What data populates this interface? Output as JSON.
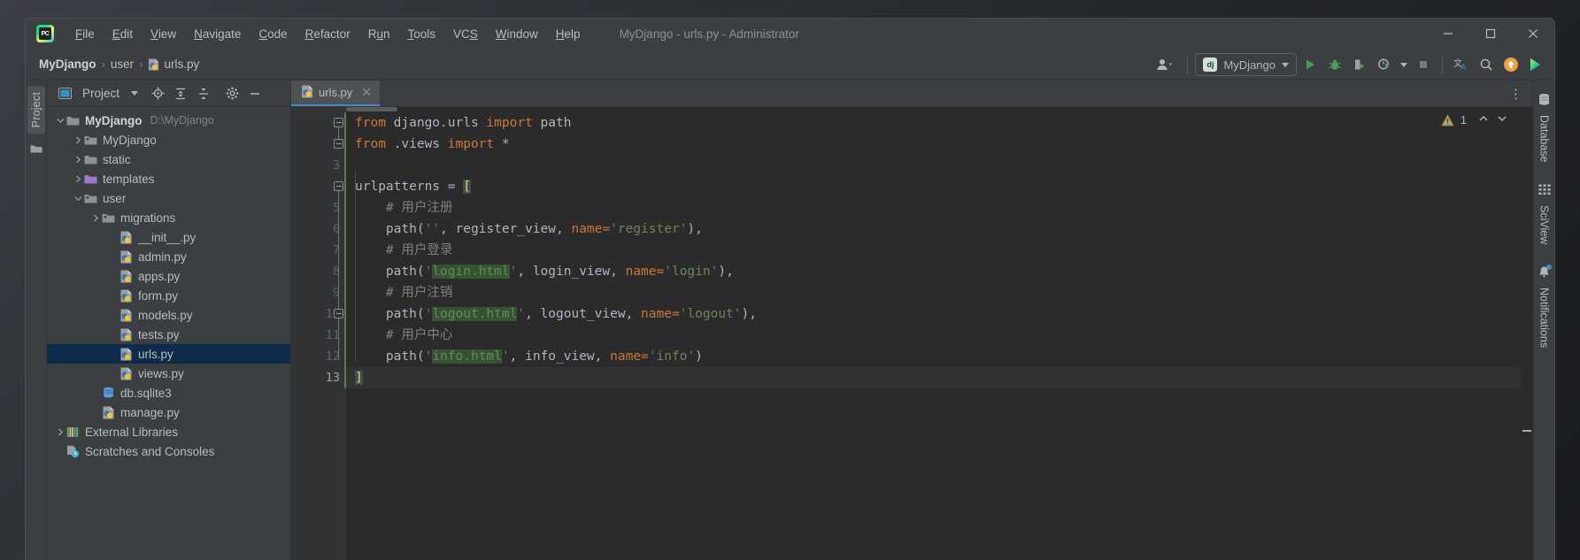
{
  "window": {
    "title": "MyDjango - urls.py - Administrator",
    "logo_text": "PC",
    "minimize": "—",
    "maximize": "□",
    "close": "✕"
  },
  "menu": {
    "items": [
      {
        "label": "File",
        "mnemonic": "F"
      },
      {
        "label": "Edit",
        "mnemonic": "E"
      },
      {
        "label": "View",
        "mnemonic": "V"
      },
      {
        "label": "Navigate",
        "mnemonic": "N"
      },
      {
        "label": "Code",
        "mnemonic": "C"
      },
      {
        "label": "Refactor",
        "mnemonic": "R"
      },
      {
        "label": "Run",
        "mnemonic": "u"
      },
      {
        "label": "Tools",
        "mnemonic": "T"
      },
      {
        "label": "VCS",
        "mnemonic": "S"
      },
      {
        "label": "Window",
        "mnemonic": "W"
      },
      {
        "label": "Help",
        "mnemonic": "H"
      }
    ]
  },
  "navbar": {
    "breadcrumb": [
      {
        "label": "MyDjango",
        "icon": "",
        "bold": true
      },
      {
        "label": "user",
        "icon": "",
        "bold": false
      },
      {
        "label": "urls.py",
        "icon": "python-file-icon",
        "bold": false
      }
    ],
    "separator": "›",
    "run_config": {
      "label": "MyDjango",
      "badge": "dj"
    },
    "icons": [
      "user-account-icon",
      "run-icon",
      "debug-icon",
      "coverage-icon",
      "profile-icon",
      "stop-icon",
      "translate-icon",
      "search-icon",
      "update-icon",
      "ide-features-icon"
    ]
  },
  "left_strip": {
    "tab_label": "Project",
    "folder_icon": "folder-icon"
  },
  "project_panel": {
    "title": "Project",
    "header_icons": [
      "project-view-icon",
      "chevron-down-icon",
      "locate-icon",
      "expand-all-icon",
      "collapse-all-icon",
      "settings-gear-icon",
      "hide-icon"
    ],
    "tree": [
      {
        "depth": 0,
        "label": "MyDjango",
        "path": "D:\\MyDjango",
        "icon": "folder-icon",
        "arrow": "down",
        "bold": true,
        "selected": false
      },
      {
        "depth": 1,
        "label": "MyDjango",
        "path": "",
        "icon": "module-folder-icon",
        "arrow": "right",
        "bold": false,
        "selected": false
      },
      {
        "depth": 1,
        "label": "static",
        "path": "",
        "icon": "folder-icon",
        "arrow": "right",
        "bold": false,
        "selected": false
      },
      {
        "depth": 1,
        "label": "templates",
        "path": "",
        "icon": "templates-folder-icon",
        "arrow": "right",
        "bold": false,
        "selected": false
      },
      {
        "depth": 1,
        "label": "user",
        "path": "",
        "icon": "module-folder-icon",
        "arrow": "down",
        "bold": false,
        "selected": false
      },
      {
        "depth": 2,
        "label": "migrations",
        "path": "",
        "icon": "module-folder-icon",
        "arrow": "right",
        "bold": false,
        "selected": false
      },
      {
        "depth": 3,
        "label": "__init__.py",
        "path": "",
        "icon": "python-file-icon",
        "arrow": "none",
        "bold": false,
        "selected": false
      },
      {
        "depth": 3,
        "label": "admin.py",
        "path": "",
        "icon": "python-file-icon",
        "arrow": "none",
        "bold": false,
        "selected": false
      },
      {
        "depth": 3,
        "label": "apps.py",
        "path": "",
        "icon": "python-file-icon",
        "arrow": "none",
        "bold": false,
        "selected": false
      },
      {
        "depth": 3,
        "label": "form.py",
        "path": "",
        "icon": "python-file-icon",
        "arrow": "none",
        "bold": false,
        "selected": false
      },
      {
        "depth": 3,
        "label": "models.py",
        "path": "",
        "icon": "python-file-icon",
        "arrow": "none",
        "bold": false,
        "selected": false
      },
      {
        "depth": 3,
        "label": "tests.py",
        "path": "",
        "icon": "python-file-icon",
        "arrow": "none",
        "bold": false,
        "selected": false
      },
      {
        "depth": 3,
        "label": "urls.py",
        "path": "",
        "icon": "python-file-icon",
        "arrow": "none",
        "bold": false,
        "selected": true
      },
      {
        "depth": 3,
        "label": "views.py",
        "path": "",
        "icon": "python-file-icon",
        "arrow": "none",
        "bold": false,
        "selected": false
      },
      {
        "depth": 2,
        "label": "db.sqlite3",
        "path": "",
        "icon": "database-icon",
        "arrow": "none",
        "bold": false,
        "selected": false
      },
      {
        "depth": 2,
        "label": "manage.py",
        "path": "",
        "icon": "python-file-icon",
        "arrow": "none",
        "bold": false,
        "selected": false
      },
      {
        "depth": 0,
        "label": "External Libraries",
        "path": "",
        "icon": "libraries-icon",
        "arrow": "right",
        "bold": false,
        "selected": false
      },
      {
        "depth": 0,
        "label": "Scratches and Consoles",
        "path": "",
        "icon": "scratches-icon",
        "arrow": "none",
        "bold": false,
        "selected": false
      }
    ]
  },
  "editor": {
    "tab": {
      "label": "urls.py",
      "icon": "python-file-icon",
      "close": "✕"
    },
    "kebab": "⋮",
    "inspection": {
      "warning_count": "1",
      "icon": "warning-triangle-icon",
      "up": "prev-problem-icon",
      "down": "next-problem-icon"
    },
    "lines": [
      {
        "n": "1",
        "tokens": [
          {
            "t": "from",
            "c": "kw"
          },
          {
            "t": " django.urls ",
            "c": "pl"
          },
          {
            "t": "import",
            "c": "kw"
          },
          {
            "t": " path",
            "c": "pl"
          }
        ]
      },
      {
        "n": "2",
        "tokens": [
          {
            "t": "from",
            "c": "kw"
          },
          {
            "t": " .views ",
            "c": "pl"
          },
          {
            "t": "import",
            "c": "kw"
          },
          {
            "t": " *",
            "c": "pl"
          }
        ]
      },
      {
        "n": "3",
        "tokens": []
      },
      {
        "n": "4",
        "tokens": [
          {
            "t": "urlpatterns",
            "c": "pl"
          },
          {
            "t": " = ",
            "c": "punc"
          },
          {
            "t": "[",
            "c": "brk"
          }
        ]
      },
      {
        "n": "5",
        "tokens": [
          {
            "t": "    # 用户注册",
            "c": "com"
          }
        ]
      },
      {
        "n": "6",
        "tokens": [
          {
            "t": "    path(",
            "c": "pl"
          },
          {
            "t": "''",
            "c": "str"
          },
          {
            "t": ", register_view, ",
            "c": "pl"
          },
          {
            "t": "name=",
            "c": "kwarg"
          },
          {
            "t": "'register'",
            "c": "str"
          },
          {
            "t": "),",
            "c": "pl"
          }
        ]
      },
      {
        "n": "7",
        "tokens": [
          {
            "t": "    # 用户登录",
            "c": "com"
          }
        ]
      },
      {
        "n": "8",
        "tokens": [
          {
            "t": "    path(",
            "c": "pl"
          },
          {
            "t": "'",
            "c": "str"
          },
          {
            "t": "login.html",
            "c": "str hl"
          },
          {
            "t": "'",
            "c": "str"
          },
          {
            "t": ", login_view, ",
            "c": "pl"
          },
          {
            "t": "name=",
            "c": "kwarg"
          },
          {
            "t": "'login'",
            "c": "str"
          },
          {
            "t": "),",
            "c": "pl"
          }
        ]
      },
      {
        "n": "9",
        "tokens": [
          {
            "t": "    # 用户注销",
            "c": "com"
          }
        ]
      },
      {
        "n": "10",
        "tokens": [
          {
            "t": "    path(",
            "c": "pl"
          },
          {
            "t": "'",
            "c": "str"
          },
          {
            "t": "logout.html",
            "c": "str hl"
          },
          {
            "t": "'",
            "c": "str"
          },
          {
            "t": ", logout_view, ",
            "c": "pl"
          },
          {
            "t": "name=",
            "c": "kwarg"
          },
          {
            "t": "'logout'",
            "c": "str"
          },
          {
            "t": "),",
            "c": "pl"
          }
        ]
      },
      {
        "n": "11",
        "tokens": [
          {
            "t": "    # 用户中心",
            "c": "com"
          }
        ]
      },
      {
        "n": "12",
        "tokens": [
          {
            "t": "    path(",
            "c": "pl"
          },
          {
            "t": "'",
            "c": "str"
          },
          {
            "t": "info.html",
            "c": "str hl"
          },
          {
            "t": "'",
            "c": "str"
          },
          {
            "t": ", info_view, ",
            "c": "pl"
          },
          {
            "t": "name=",
            "c": "kwarg"
          },
          {
            "t": "'info'",
            "c": "str"
          },
          {
            "t": ")",
            "c": "pl"
          }
        ]
      },
      {
        "n": "13",
        "tokens": [
          {
            "t": "]",
            "c": "brk2"
          }
        ],
        "current": true
      }
    ]
  },
  "right_strip": {
    "tabs": [
      {
        "label": "Database",
        "icon": "database-icon",
        "badge": false
      },
      {
        "label": "SciView",
        "icon": "grid-icon",
        "badge": false
      },
      {
        "label": "Notifications",
        "icon": "bell-icon",
        "badge": true
      }
    ]
  },
  "colors": {
    "accent_blue": "#4a88c7",
    "selection": "#0d2c4b",
    "panel_bg": "#3c3f41",
    "editor_bg": "#2b2b2b",
    "gutter_bg": "#313335",
    "keyword": "#cc7832",
    "string": "#6a8759",
    "plain": "#a9b7c6",
    "comment": "#808080",
    "bracket_hl": "#ffc66d",
    "usage_hl": "#355235"
  }
}
